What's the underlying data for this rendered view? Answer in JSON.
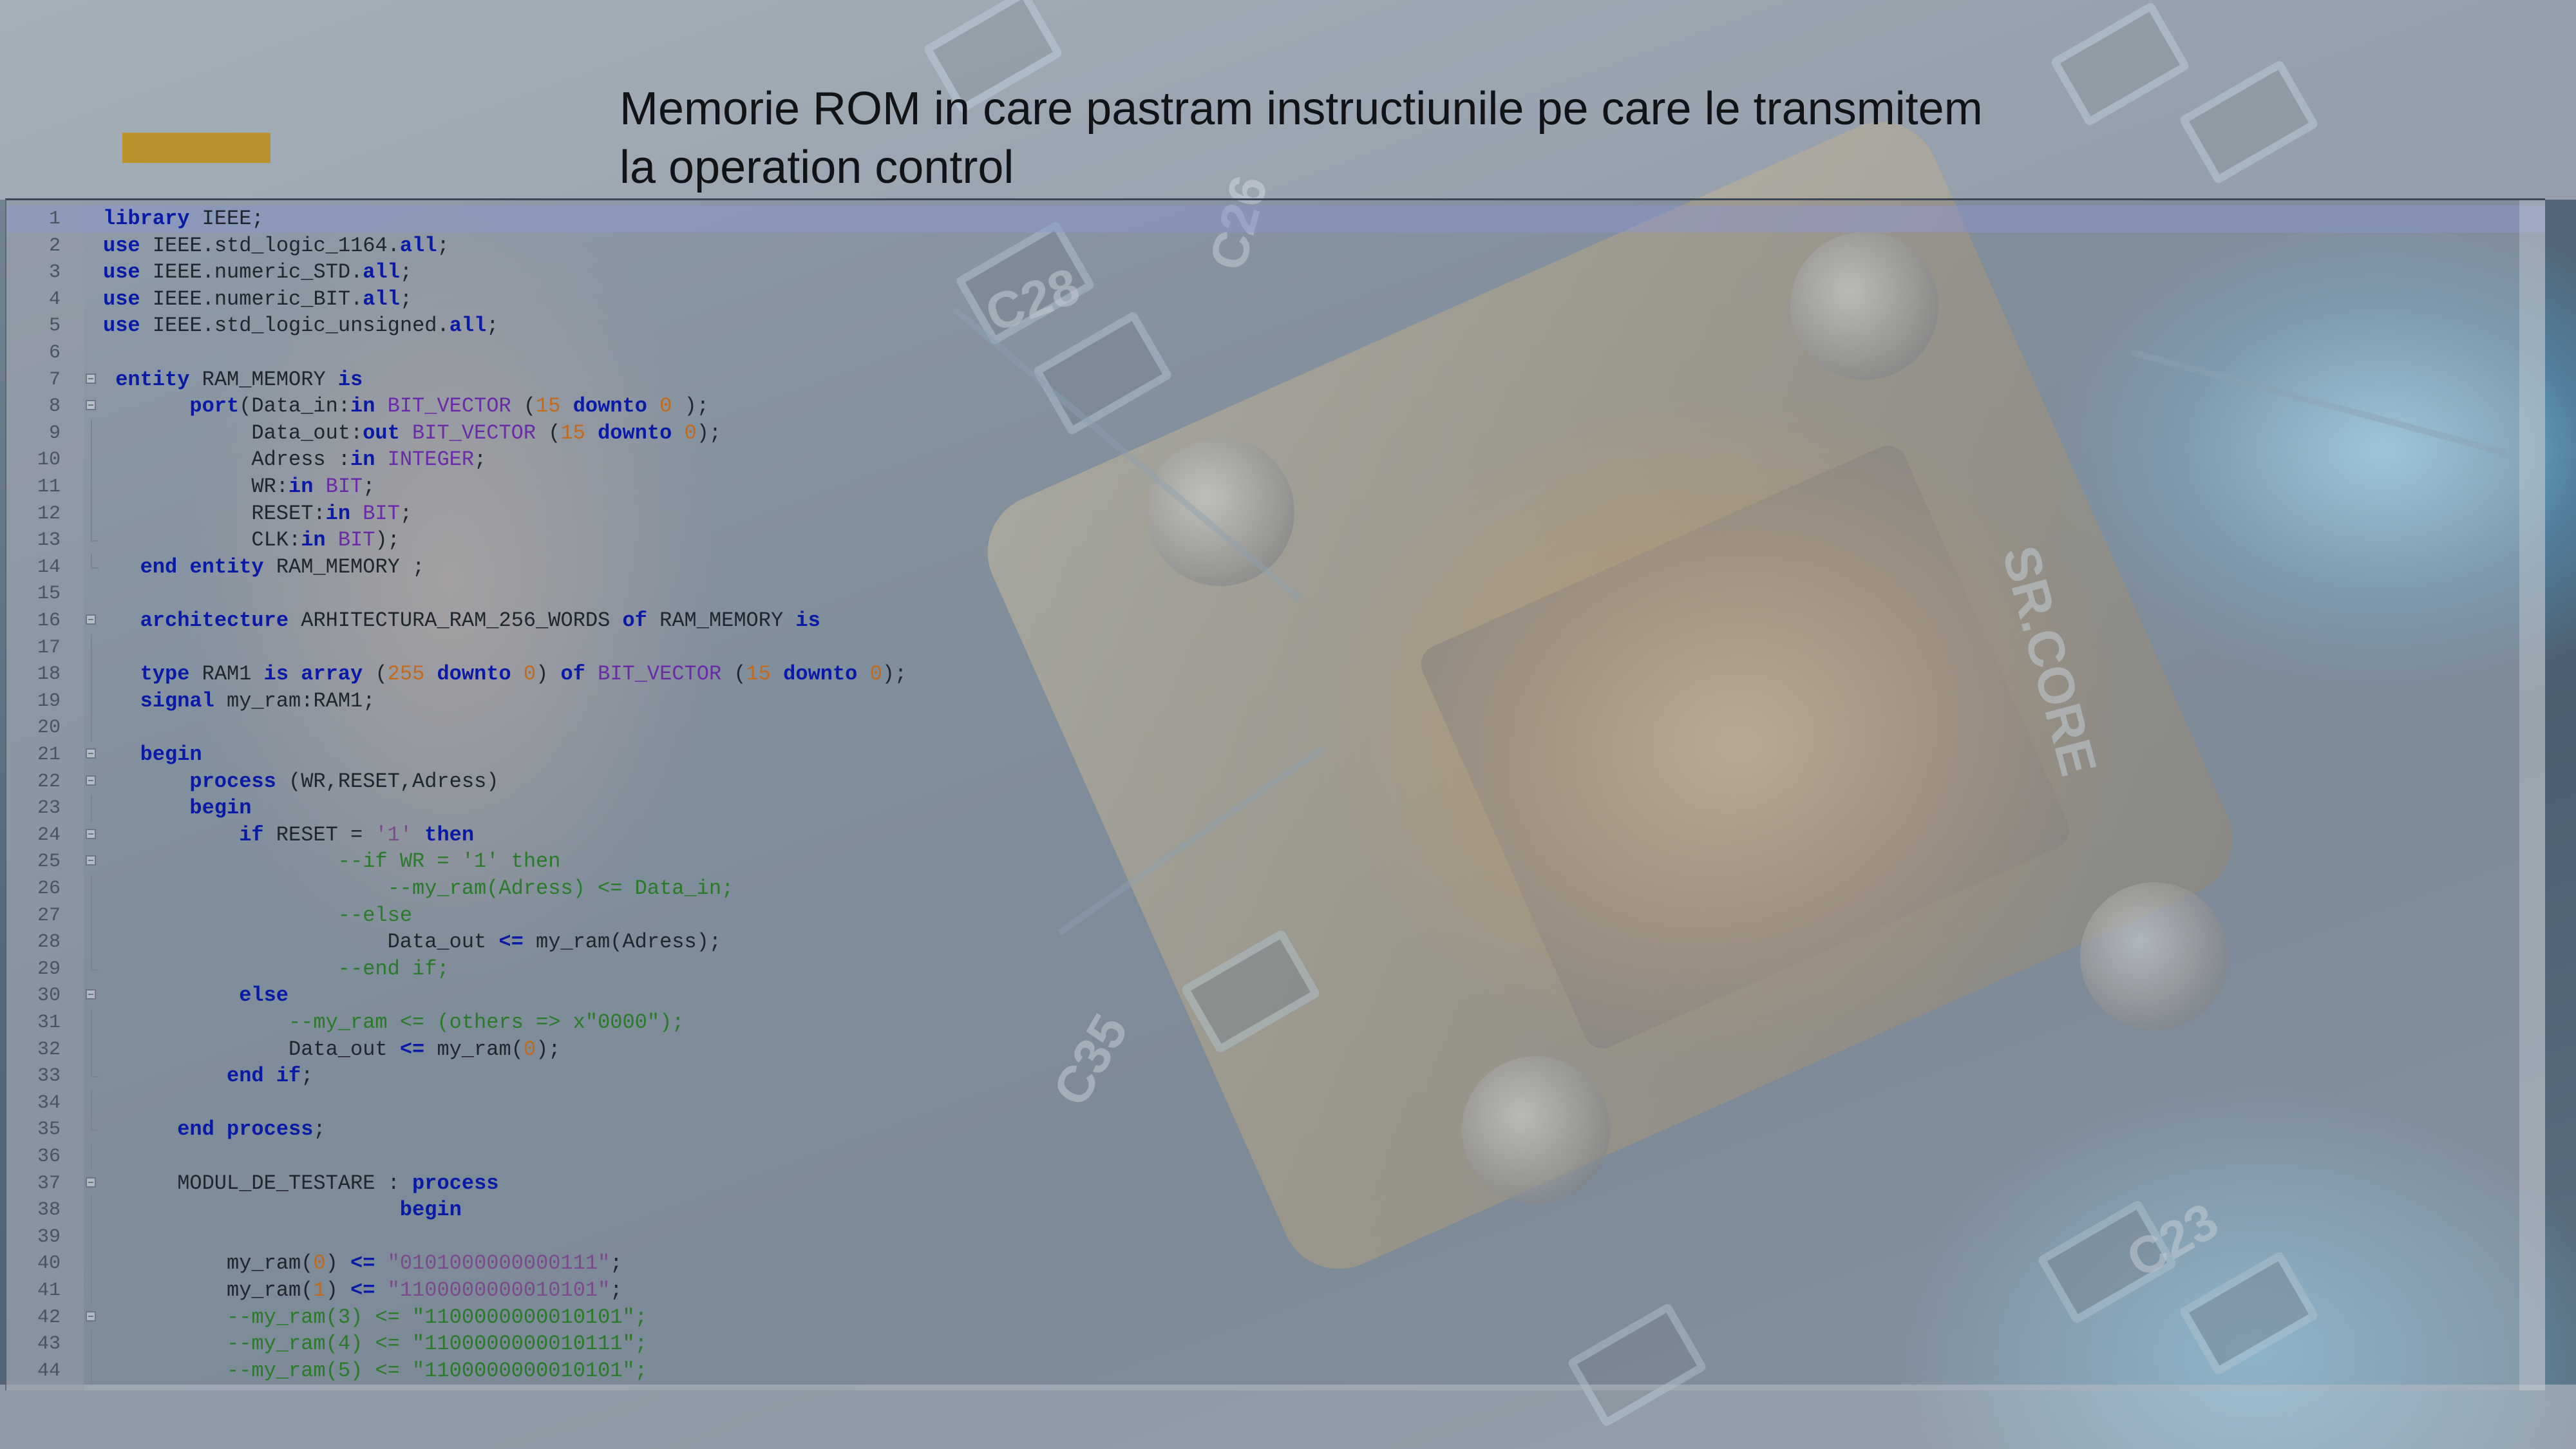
{
  "slide": {
    "title_line1": "Memorie ROM in care pastram instructiunile pe care le transmitem",
    "title_line2": "la operation control",
    "accent_color": "#b8922a"
  },
  "editor": {
    "lines": [
      {
        "n": "1",
        "indent": 0,
        "fold": "",
        "tokens": [
          {
            "c": "k",
            "v": "library"
          },
          {
            "c": "i",
            "v": " IEEE;"
          }
        ]
      },
      {
        "n": "2",
        "indent": 0,
        "fold": "",
        "tokens": [
          {
            "c": "k",
            "v": "use"
          },
          {
            "c": "i",
            "v": " IEEE.std_logic_1164."
          },
          {
            "c": "k",
            "v": "all"
          },
          {
            "c": "i",
            "v": ";"
          }
        ]
      },
      {
        "n": "3",
        "indent": 0,
        "fold": "",
        "tokens": [
          {
            "c": "k",
            "v": "use"
          },
          {
            "c": "i",
            "v": " IEEE.numeric_STD."
          },
          {
            "c": "k",
            "v": "all"
          },
          {
            "c": "i",
            "v": ";"
          }
        ]
      },
      {
        "n": "4",
        "indent": 0,
        "fold": "",
        "tokens": [
          {
            "c": "k",
            "v": "use"
          },
          {
            "c": "i",
            "v": " IEEE.numeric_BIT."
          },
          {
            "c": "k",
            "v": "all"
          },
          {
            "c": "i",
            "v": ";"
          }
        ]
      },
      {
        "n": "5",
        "indent": 0,
        "fold": "",
        "tokens": [
          {
            "c": "k",
            "v": "use"
          },
          {
            "c": "i",
            "v": " IEEE.std_logic_unsigned."
          },
          {
            "c": "k",
            "v": "all"
          },
          {
            "c": "i",
            "v": ";"
          }
        ]
      },
      {
        "n": "6",
        "indent": 0,
        "fold": "",
        "tokens": []
      },
      {
        "n": "7",
        "indent": 1,
        "fold": "open",
        "tokens": [
          {
            "c": "k",
            "v": "entity"
          },
          {
            "c": "i",
            "v": " RAM_MEMORY "
          },
          {
            "c": "k",
            "v": "is"
          }
        ]
      },
      {
        "n": "8",
        "indent": 7,
        "fold": "open",
        "tokens": [
          {
            "c": "k",
            "v": "port"
          },
          {
            "c": "i",
            "v": "(Data_in:"
          },
          {
            "c": "k",
            "v": "in"
          },
          {
            "c": "i",
            "v": " "
          },
          {
            "c": "t",
            "v": "BIT_VECTOR"
          },
          {
            "c": "i",
            "v": " ("
          },
          {
            "c": "n",
            "v": "15"
          },
          {
            "c": "i",
            "v": " "
          },
          {
            "c": "k",
            "v": "downto"
          },
          {
            "c": "i",
            "v": " "
          },
          {
            "c": "n",
            "v": "0"
          },
          {
            "c": "i",
            "v": " );"
          }
        ]
      },
      {
        "n": "9",
        "indent": 12,
        "fold": "mid",
        "tokens": [
          {
            "c": "i",
            "v": "Data_out:"
          },
          {
            "c": "k",
            "v": "out"
          },
          {
            "c": "i",
            "v": " "
          },
          {
            "c": "t",
            "v": "BIT_VECTOR"
          },
          {
            "c": "i",
            "v": " ("
          },
          {
            "c": "n",
            "v": "15"
          },
          {
            "c": "i",
            "v": " "
          },
          {
            "c": "k",
            "v": "downto"
          },
          {
            "c": "i",
            "v": " "
          },
          {
            "c": "n",
            "v": "0"
          },
          {
            "c": "i",
            "v": ");"
          }
        ]
      },
      {
        "n": "10",
        "indent": 12,
        "fold": "mid",
        "tokens": [
          {
            "c": "i",
            "v": "Adress :"
          },
          {
            "c": "k",
            "v": "in"
          },
          {
            "c": "i",
            "v": " "
          },
          {
            "c": "t",
            "v": "INTEGER"
          },
          {
            "c": "i",
            "v": ";"
          }
        ]
      },
      {
        "n": "11",
        "indent": 12,
        "fold": "mid",
        "tokens": [
          {
            "c": "i",
            "v": "WR:"
          },
          {
            "c": "k",
            "v": "in"
          },
          {
            "c": "i",
            "v": " "
          },
          {
            "c": "t",
            "v": "BIT"
          },
          {
            "c": "i",
            "v": ";"
          }
        ]
      },
      {
        "n": "12",
        "indent": 12,
        "fold": "mid",
        "tokens": [
          {
            "c": "i",
            "v": "RESET:"
          },
          {
            "c": "k",
            "v": "in"
          },
          {
            "c": "i",
            "v": " "
          },
          {
            "c": "t",
            "v": "BIT"
          },
          {
            "c": "i",
            "v": ";"
          }
        ]
      },
      {
        "n": "13",
        "indent": 12,
        "fold": "end",
        "tokens": [
          {
            "c": "i",
            "v": "CLK:"
          },
          {
            "c": "k",
            "v": "in"
          },
          {
            "c": "i",
            "v": " "
          },
          {
            "c": "t",
            "v": "BIT"
          },
          {
            "c": "i",
            "v": ");"
          }
        ]
      },
      {
        "n": "14",
        "indent": 3,
        "fold": "end",
        "tokens": [
          {
            "c": "k",
            "v": "end"
          },
          {
            "c": "i",
            "v": " "
          },
          {
            "c": "k",
            "v": "entity"
          },
          {
            "c": "i",
            "v": " RAM_MEMORY ;"
          }
        ]
      },
      {
        "n": "15",
        "indent": 0,
        "fold": "",
        "tokens": []
      },
      {
        "n": "16",
        "indent": 3,
        "fold": "open",
        "tokens": [
          {
            "c": "k",
            "v": "architecture"
          },
          {
            "c": "i",
            "v": " ARHITECTURA_RAM_256_WORDS "
          },
          {
            "c": "k",
            "v": "of"
          },
          {
            "c": "i",
            "v": " RAM_MEMORY "
          },
          {
            "c": "k",
            "v": "is"
          }
        ]
      },
      {
        "n": "17",
        "indent": 0,
        "fold": "mid",
        "tokens": []
      },
      {
        "n": "18",
        "indent": 3,
        "fold": "mid",
        "tokens": [
          {
            "c": "k",
            "v": "type"
          },
          {
            "c": "i",
            "v": " RAM1 "
          },
          {
            "c": "k",
            "v": "is"
          },
          {
            "c": "i",
            "v": " "
          },
          {
            "c": "k",
            "v": "array"
          },
          {
            "c": "i",
            "v": " ("
          },
          {
            "c": "n",
            "v": "255"
          },
          {
            "c": "i",
            "v": " "
          },
          {
            "c": "k",
            "v": "downto"
          },
          {
            "c": "i",
            "v": " "
          },
          {
            "c": "n",
            "v": "0"
          },
          {
            "c": "i",
            "v": ") "
          },
          {
            "c": "k",
            "v": "of"
          },
          {
            "c": "i",
            "v": " "
          },
          {
            "c": "t",
            "v": "BIT_VECTOR"
          },
          {
            "c": "i",
            "v": " ("
          },
          {
            "c": "n",
            "v": "15"
          },
          {
            "c": "i",
            "v": " "
          },
          {
            "c": "k",
            "v": "downto"
          },
          {
            "c": "i",
            "v": " "
          },
          {
            "c": "n",
            "v": "0"
          },
          {
            "c": "i",
            "v": ");"
          }
        ]
      },
      {
        "n": "19",
        "indent": 3,
        "fold": "mid",
        "tokens": [
          {
            "c": "k",
            "v": "signal"
          },
          {
            "c": "i",
            "v": " my_ram:RAM1;"
          }
        ]
      },
      {
        "n": "20",
        "indent": 0,
        "fold": "mid",
        "tokens": []
      },
      {
        "n": "21",
        "indent": 3,
        "fold": "open",
        "tokens": [
          {
            "c": "k",
            "v": "begin"
          }
        ]
      },
      {
        "n": "22",
        "indent": 7,
        "fold": "open",
        "tokens": [
          {
            "c": "k",
            "v": "process"
          },
          {
            "c": "i",
            "v": " (WR,RESET,Adress)"
          }
        ]
      },
      {
        "n": "23",
        "indent": 7,
        "fold": "mid",
        "tokens": [
          {
            "c": "k",
            "v": "begin"
          }
        ]
      },
      {
        "n": "24",
        "indent": 11,
        "fold": "open",
        "tokens": [
          {
            "c": "k",
            "v": "if"
          },
          {
            "c": "i",
            "v": " RESET = "
          },
          {
            "c": "s",
            "v": "'1'"
          },
          {
            "c": "i",
            "v": " "
          },
          {
            "c": "k",
            "v": "then"
          }
        ]
      },
      {
        "n": "25",
        "indent": 19,
        "fold": "open",
        "tokens": [
          {
            "c": "c",
            "v": "--if WR = '1' then"
          }
        ]
      },
      {
        "n": "26",
        "indent": 23,
        "fold": "mid",
        "tokens": [
          {
            "c": "c",
            "v": "--my_ram(Adress) <= Data_in;"
          }
        ]
      },
      {
        "n": "27",
        "indent": 19,
        "fold": "mid",
        "tokens": [
          {
            "c": "c",
            "v": "--else"
          }
        ]
      },
      {
        "n": "28",
        "indent": 23,
        "fold": "mid",
        "tokens": [
          {
            "c": "i",
            "v": "Data_out "
          },
          {
            "c": "k",
            "v": "<="
          },
          {
            "c": "i",
            "v": " my_ram(Adress);"
          }
        ]
      },
      {
        "n": "29",
        "indent": 19,
        "fold": "end",
        "tokens": [
          {
            "c": "c",
            "v": "--end if;"
          }
        ]
      },
      {
        "n": "30",
        "indent": 11,
        "fold": "open",
        "tokens": [
          {
            "c": "k",
            "v": "else"
          }
        ]
      },
      {
        "n": "31",
        "indent": 15,
        "fold": "mid",
        "tokens": [
          {
            "c": "c",
            "v": "--my_ram <= (others => x\"0000\");"
          }
        ]
      },
      {
        "n": "32",
        "indent": 15,
        "fold": "mid",
        "tokens": [
          {
            "c": "i",
            "v": "Data_out "
          },
          {
            "c": "k",
            "v": "<="
          },
          {
            "c": "i",
            "v": " my_ram("
          },
          {
            "c": "n",
            "v": "0"
          },
          {
            "c": "i",
            "v": ");"
          }
        ]
      },
      {
        "n": "33",
        "indent": 10,
        "fold": "end",
        "tokens": [
          {
            "c": "k",
            "v": "end"
          },
          {
            "c": "i",
            "v": " "
          },
          {
            "c": "k",
            "v": "if"
          },
          {
            "c": "i",
            "v": ";"
          }
        ]
      },
      {
        "n": "34",
        "indent": 0,
        "fold": "mid",
        "tokens": []
      },
      {
        "n": "35",
        "indent": 6,
        "fold": "end",
        "tokens": [
          {
            "c": "k",
            "v": "end"
          },
          {
            "c": "i",
            "v": " "
          },
          {
            "c": "k",
            "v": "process"
          },
          {
            "c": "i",
            "v": ";"
          }
        ]
      },
      {
        "n": "36",
        "indent": 0,
        "fold": "mid",
        "tokens": []
      },
      {
        "n": "37",
        "indent": 6,
        "fold": "open",
        "tokens": [
          {
            "c": "i",
            "v": "MODUL_DE_TESTARE : "
          },
          {
            "c": "k",
            "v": "process"
          }
        ]
      },
      {
        "n": "38",
        "indent": 24,
        "fold": "mid",
        "tokens": [
          {
            "c": "k",
            "v": "begin"
          }
        ]
      },
      {
        "n": "39",
        "indent": 0,
        "fold": "mid",
        "tokens": []
      },
      {
        "n": "40",
        "indent": 10,
        "fold": "mid",
        "tokens": [
          {
            "c": "i",
            "v": "my_ram("
          },
          {
            "c": "n",
            "v": "0"
          },
          {
            "c": "i",
            "v": ") "
          },
          {
            "c": "k",
            "v": "<="
          },
          {
            "c": "i",
            "v": " "
          },
          {
            "c": "s",
            "v": "\"0101000000000111\""
          },
          {
            "c": "i",
            "v": ";"
          }
        ]
      },
      {
        "n": "41",
        "indent": 10,
        "fold": "mid",
        "tokens": [
          {
            "c": "i",
            "v": "my_ram("
          },
          {
            "c": "n",
            "v": "1"
          },
          {
            "c": "i",
            "v": ") "
          },
          {
            "c": "k",
            "v": "<="
          },
          {
            "c": "i",
            "v": " "
          },
          {
            "c": "s",
            "v": "\"1100000000010101\""
          },
          {
            "c": "i",
            "v": ";"
          }
        ]
      },
      {
        "n": "42",
        "indent": 10,
        "fold": "open",
        "tokens": [
          {
            "c": "c",
            "v": "--my_ram(3) <= \"1100000000010101\";"
          }
        ]
      },
      {
        "n": "43",
        "indent": 10,
        "fold": "mid",
        "tokens": [
          {
            "c": "c",
            "v": "--my_ram(4) <= \"1100000000010111\";"
          }
        ]
      },
      {
        "n": "44",
        "indent": 10,
        "fold": "mid",
        "tokens": [
          {
            "c": "c",
            "v": "--my_ram(5) <= \"1100000000010101\";"
          }
        ]
      }
    ]
  }
}
